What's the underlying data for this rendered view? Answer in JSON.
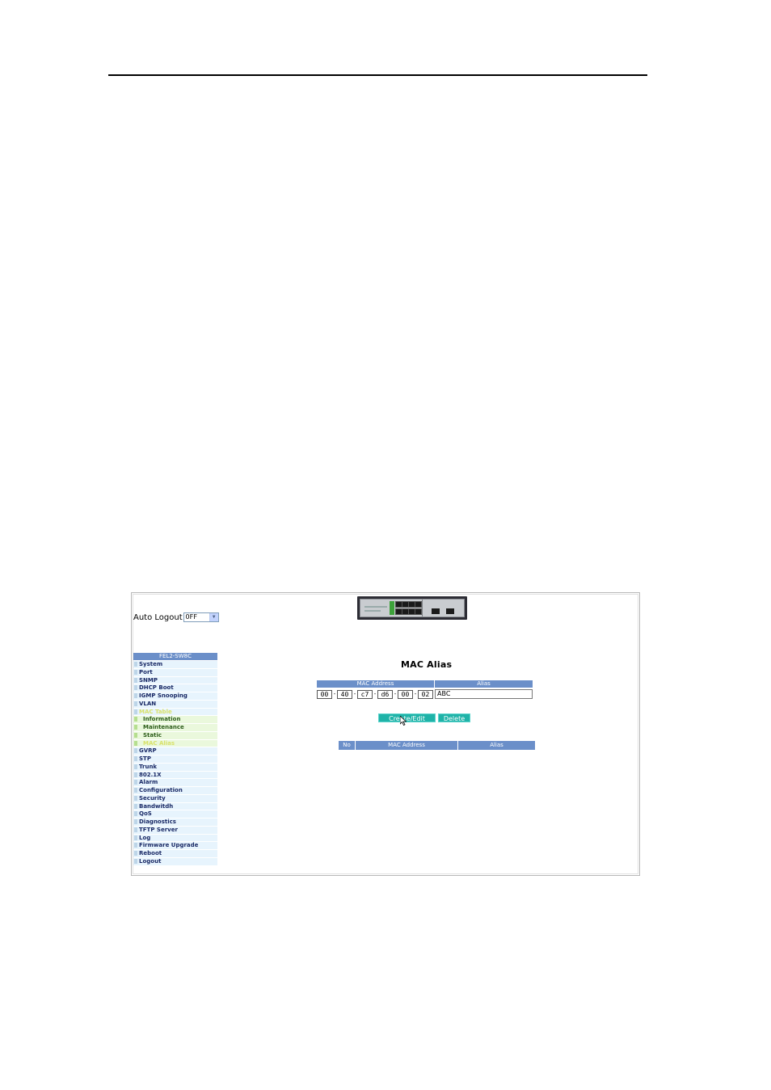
{
  "auto_logout": {
    "label": "Auto Logout",
    "value": "OFF"
  },
  "menu": {
    "header": "FEL2-SW8C",
    "items": [
      {
        "label": "System",
        "sub": false,
        "active": false
      },
      {
        "label": "Port",
        "sub": false,
        "active": false
      },
      {
        "label": "SNMP",
        "sub": false,
        "active": false
      },
      {
        "label": "DHCP Boot",
        "sub": false,
        "active": false
      },
      {
        "label": "IGMP Snooping",
        "sub": false,
        "active": false
      },
      {
        "label": "VLAN",
        "sub": false,
        "active": false
      },
      {
        "label": "MAC Table",
        "sub": false,
        "active": true
      },
      {
        "label": "Information",
        "sub": true,
        "active": false
      },
      {
        "label": "Maintenance",
        "sub": true,
        "active": false
      },
      {
        "label": "Static",
        "sub": true,
        "active": false
      },
      {
        "label": "MAC Alias",
        "sub": true,
        "active": true
      },
      {
        "label": "GVRP",
        "sub": false,
        "active": false
      },
      {
        "label": "STP",
        "sub": false,
        "active": false
      },
      {
        "label": "Trunk",
        "sub": false,
        "active": false
      },
      {
        "label": "802.1X",
        "sub": false,
        "active": false
      },
      {
        "label": "Alarm",
        "sub": false,
        "active": false
      },
      {
        "label": "Configuration",
        "sub": false,
        "active": false
      },
      {
        "label": "Security",
        "sub": false,
        "active": false
      },
      {
        "label": "Bandwitdh",
        "sub": false,
        "active": false
      },
      {
        "label": "QoS",
        "sub": false,
        "active": false
      },
      {
        "label": "Diagnostics",
        "sub": false,
        "active": false
      },
      {
        "label": "TFTP Server",
        "sub": false,
        "active": false
      },
      {
        "label": "Log",
        "sub": false,
        "active": false
      },
      {
        "label": "Firmware Upgrade",
        "sub": false,
        "active": false
      },
      {
        "label": "Reboot",
        "sub": false,
        "active": false
      },
      {
        "label": "Logout",
        "sub": false,
        "active": false
      }
    ]
  },
  "page_title": "MAC Alias",
  "form": {
    "mac_header": "MAC Address",
    "alias_header": "Alias",
    "mac_octets": [
      "00",
      "40",
      "c7",
      "d6",
      "00",
      "02"
    ],
    "mac_separator": "-",
    "alias_value": "ABC"
  },
  "buttons": {
    "create_edit": "Create/Edit",
    "delete": "Delete"
  },
  "list": {
    "col_no": "No",
    "col_mac": "MAC Address",
    "col_alias": "Alias"
  },
  "colors": {
    "header_blue": "#6b8fc9",
    "button_teal": "#1fb3a8",
    "menu_bg": "#e7f4fd",
    "submenu_bg": "#eaf8dc",
    "active_text": "#d8e16a"
  }
}
